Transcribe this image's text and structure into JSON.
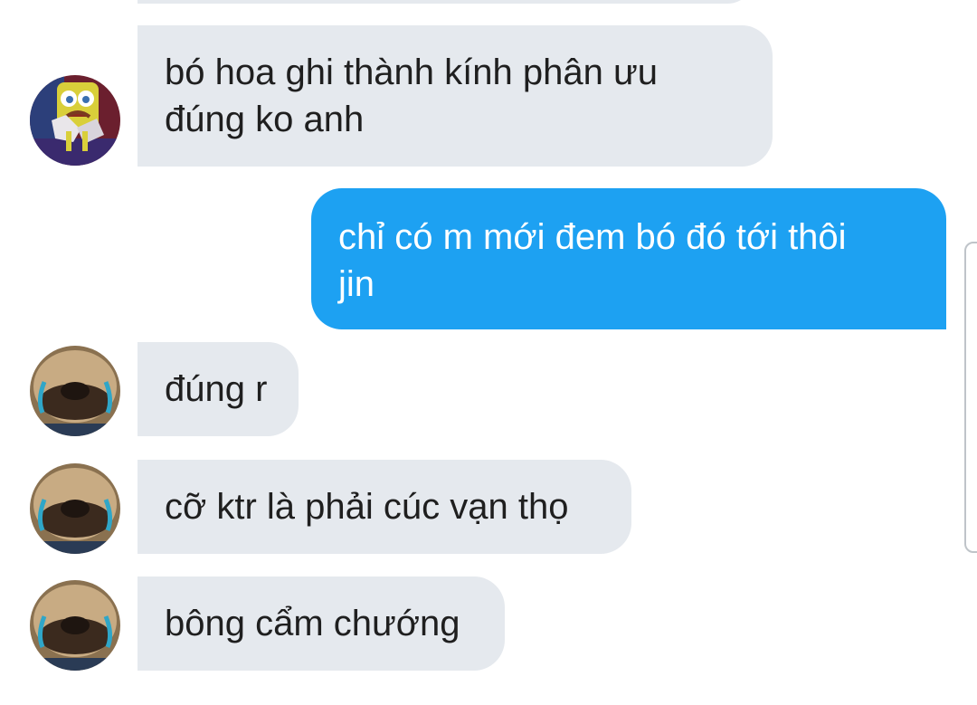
{
  "conversation": {
    "messages": [
      {
        "direction": "incoming",
        "avatar": "spongebob-crying-avatar",
        "lines": [
          "bó hoa ghi thành kính phân ưu",
          "đúng ko anh"
        ]
      },
      {
        "direction": "outgoing",
        "lines": [
          "chỉ có m mới đem bó đó tới thôi",
          "jin"
        ]
      },
      {
        "direction": "incoming",
        "avatar": "crying-dog-avatar",
        "lines": [
          "đúng r"
        ]
      },
      {
        "direction": "incoming",
        "avatar": "crying-dog-avatar",
        "lines": [
          "cỡ ktr là phải cúc vạn thọ"
        ]
      },
      {
        "direction": "incoming",
        "avatar": "crying-dog-avatar",
        "lines": [
          "bông cẩm chướng"
        ]
      }
    ]
  },
  "colors": {
    "incoming_bubble": "#e5e9ee",
    "outgoing_bubble": "#1da1f2",
    "incoming_text": "#1f1f1f",
    "outgoing_text": "#ffffff"
  }
}
